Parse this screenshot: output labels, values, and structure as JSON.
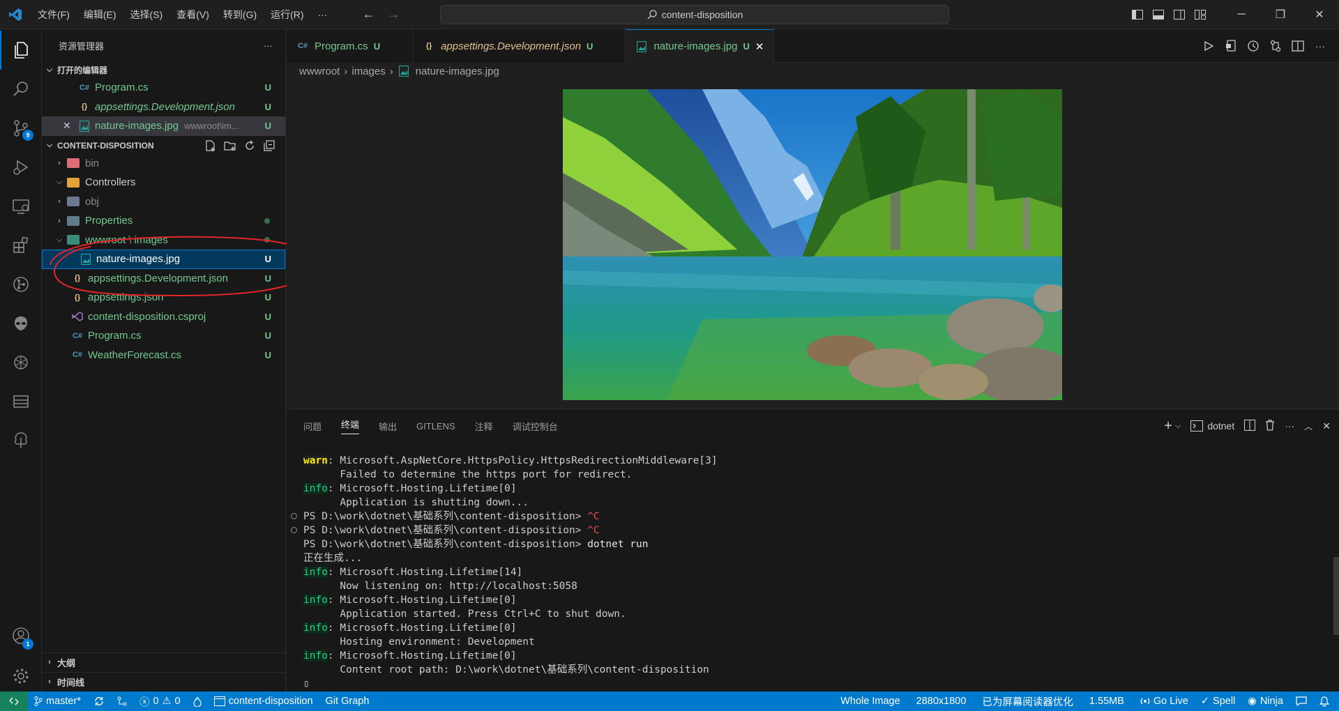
{
  "titlebar": {
    "menu": [
      "文件(F)",
      "编辑(E)",
      "选择(S)",
      "查看(V)",
      "转到(G)",
      "运行(R)",
      "···"
    ],
    "search_text": "content-disposition"
  },
  "activity": {
    "source_control_badge": "9",
    "accounts_badge": "1"
  },
  "sidebar": {
    "title": "资源管理器",
    "more": "···",
    "open_editors": {
      "header": "打开的编辑器",
      "items": [
        {
          "icon": "C#",
          "name": "Program.cs",
          "status": "U"
        },
        {
          "icon": "{}",
          "name": "appsettings.Development.json",
          "status": "U"
        },
        {
          "icon": "img",
          "name": "nature-images.jpg",
          "path": "wwwroot\\im...",
          "status": "U"
        }
      ]
    },
    "project": {
      "header": "CONTENT-DISPOSITION",
      "items": [
        {
          "name": "bin"
        },
        {
          "name": "Controllers"
        },
        {
          "name": "obj"
        },
        {
          "name": "Properties"
        },
        {
          "name": "wwwroot",
          "sep": "\\",
          "name2": "images"
        },
        {
          "name": "nature-images.jpg",
          "status": "U"
        },
        {
          "name": "appsettings.Development.json",
          "status": "U"
        },
        {
          "name": "appsettings.json",
          "status": "U"
        },
        {
          "name": "content-disposition.csproj",
          "status": "U"
        },
        {
          "name": "Program.cs",
          "status": "U"
        },
        {
          "name": "WeatherForecast.cs",
          "status": "U"
        }
      ]
    },
    "outline": "大纲",
    "timeline": "时间线"
  },
  "tabs": [
    {
      "icon": "C#",
      "name": "Program.cs",
      "status": "U"
    },
    {
      "icon": "{}",
      "name": "appsettings.Development.json",
      "status": "U"
    },
    {
      "icon": "img",
      "name": "nature-images.jpg",
      "status": "U",
      "close": "✕"
    }
  ],
  "breadcrumb": {
    "seg1": "wwwroot",
    "seg2": "images",
    "file": "nature-images.jpg"
  },
  "panel": {
    "tabs": [
      "问题",
      "终端",
      "输出",
      "GITLENS",
      "注释",
      "调试控制台"
    ],
    "terminal_name": "dotnet",
    "lines": [
      {
        "tag": "warn",
        "text": ": Microsoft.AspNetCore.HttpsPolicy.HttpsRedirectionMiddleware[3]"
      },
      {
        "text": "      Failed to determine the https port for redirect."
      },
      {
        "tag": "info",
        "text": ": Microsoft.Hosting.Lifetime[0]"
      },
      {
        "text": "      Application is shutting down..."
      },
      {
        "prompt": "PS D:\\work\\dotnet\\基础系列\\content-disposition> ",
        "ctrl": "^C",
        "circle": true
      },
      {
        "prompt": "PS D:\\work\\dotnet\\基础系列\\content-disposition> ",
        "ctrl": "^C",
        "circle": true
      },
      {
        "prompt": "PS D:\\work\\dotnet\\基础系列\\content-disposition> ",
        "cmd": "dotnet run"
      },
      {
        "text": "正在生成..."
      },
      {
        "tag": "info",
        "text": ": Microsoft.Hosting.Lifetime[14]"
      },
      {
        "text": "      Now listening on: http://localhost:5058"
      },
      {
        "tag": "info",
        "text": ": Microsoft.Hosting.Lifetime[0]"
      },
      {
        "text": "      Application started. Press Ctrl+C to shut down."
      },
      {
        "tag": "info",
        "text": ": Microsoft.Hosting.Lifetime[0]"
      },
      {
        "text": "      Hosting environment: Development"
      },
      {
        "tag": "info",
        "text": ": Microsoft.Hosting.Lifetime[0]"
      },
      {
        "text": "      Content root path: D:\\work\\dotnet\\基础系列\\content-disposition"
      },
      {
        "text": "▯"
      }
    ]
  },
  "statusbar": {
    "branch": "master*",
    "errors": "0",
    "warnings": "0",
    "folder": "content-disposition",
    "git_graph": "Git Graph",
    "whole_image": "Whole Image",
    "resolution": "2880x1800",
    "reader": "已为屏幕阅读器优化",
    "size": "1.55MB",
    "golive": "Go Live",
    "spell": "Spell",
    "ninja": "Ninja"
  },
  "colors": {
    "accent": "#0078d4",
    "status_bg": "#007acc",
    "untracked": "#73c991"
  }
}
